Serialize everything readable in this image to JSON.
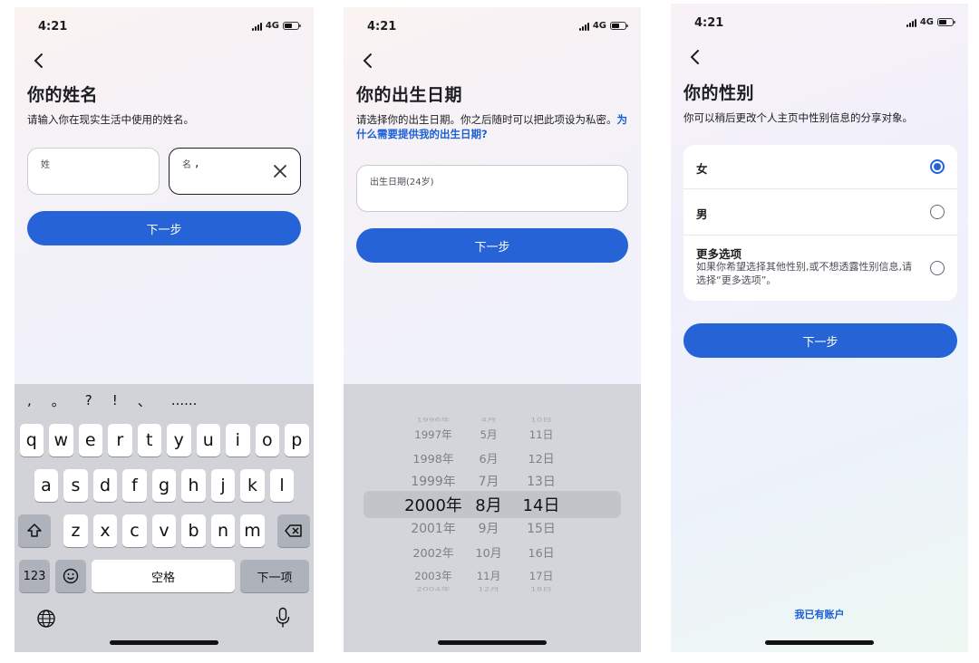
{
  "status": {
    "time": "4:21",
    "network": "4G"
  },
  "name_screen": {
    "title": "你的姓名",
    "subtitle": "请输入你在现实生活中使用的姓名。",
    "last_name_label": "姓",
    "first_name_label": "名",
    "next_label": "下一步",
    "keyboard": {
      "suggestions": [
        ",",
        "。",
        "?",
        "!",
        "、",
        "......"
      ],
      "row1": [
        "q",
        "w",
        "e",
        "r",
        "t",
        "y",
        "u",
        "i",
        "o",
        "p"
      ],
      "row2": [
        "a",
        "s",
        "d",
        "f",
        "g",
        "h",
        "j",
        "k",
        "l"
      ],
      "row3": [
        "z",
        "x",
        "c",
        "v",
        "b",
        "n",
        "m"
      ],
      "numbers_key": "123",
      "space_key": "空格",
      "next_key": "下一项"
    }
  },
  "birthday_screen": {
    "title": "你的出生日期",
    "subtitle": "请选择你的出生日期。你之后随时可以把此项设为私密。",
    "help_link": "为什么需要提供我的出生日期?",
    "field_label": "出生日期(24岁)",
    "next_label": "下一步",
    "picker": {
      "years": [
        "1996年",
        "1997年",
        "1998年",
        "1999年",
        "2000年",
        "2001年",
        "2002年",
        "2003年",
        "2004年"
      ],
      "months": [
        "4月",
        "5月",
        "6月",
        "7月",
        "8月",
        "9月",
        "10月",
        "11月",
        "12月"
      ],
      "days": [
        "10日",
        "11日",
        "12日",
        "13日",
        "14日",
        "15日",
        "16日",
        "17日",
        "18日"
      ],
      "selected_index": 4
    }
  },
  "gender_screen": {
    "title": "你的性别",
    "subtitle": "你可以稍后更改个人主页中性别信息的分享对象。",
    "options": [
      {
        "label": "女",
        "selected": true
      },
      {
        "label": "男",
        "selected": false
      },
      {
        "label": "更多选项",
        "description": "如果你希望选择其他性别,或不想透露性别信息,请选择“更多选项”。",
        "selected": false
      }
    ],
    "next_label": "下一步",
    "footer_link": "我已有账户"
  },
  "colors": {
    "accent": "#2563d6",
    "link": "#1a5fd6",
    "keyboard_bg": "#d1d3d9"
  }
}
